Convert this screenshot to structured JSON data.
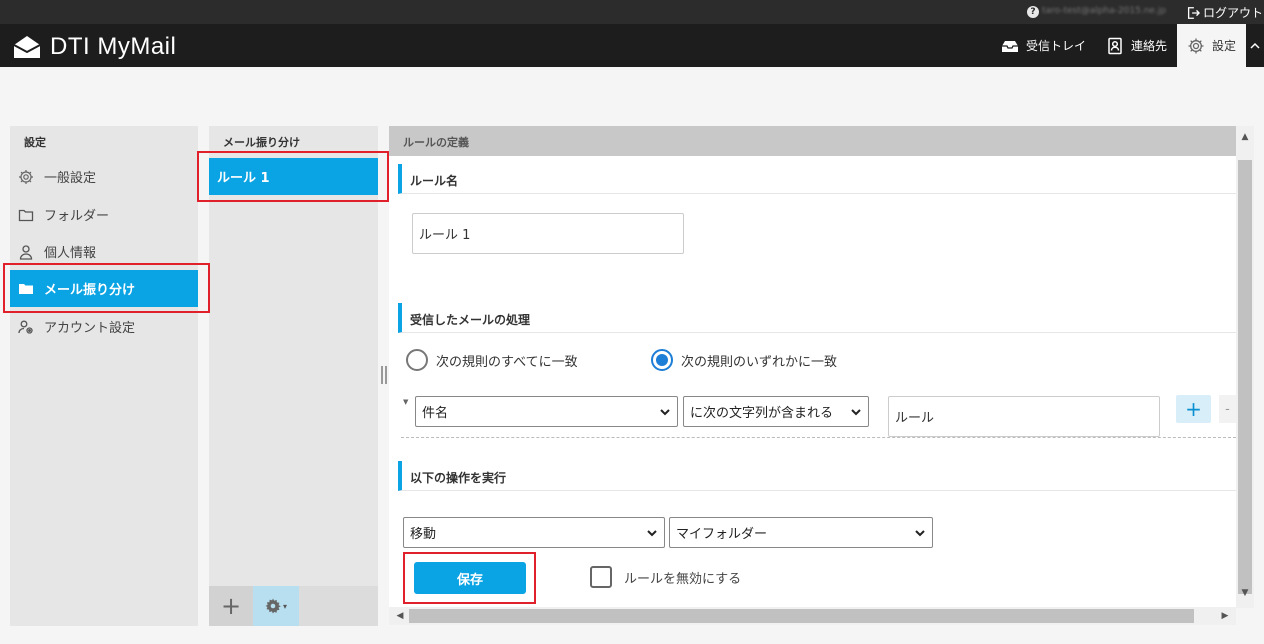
{
  "topbar": {
    "help_glyph": "?",
    "user_email": "taro-test@alpha-2015.ne.jp",
    "logout_label": "ログアウト"
  },
  "header": {
    "brand": "DTI MyMail",
    "nav": {
      "inbox": "受信トレイ",
      "contacts": "連絡先",
      "settings": "設定"
    }
  },
  "settings_panel": {
    "title": "設定",
    "items": [
      {
        "label": "一般設定",
        "icon": "gear-icon"
      },
      {
        "label": "フォルダー",
        "icon": "folder-icon"
      },
      {
        "label": "個人情報",
        "icon": "person-icon"
      },
      {
        "label": "メール振り分け",
        "icon": "folder-icon",
        "active": true
      },
      {
        "label": "アカウント設定",
        "icon": "account-settings-icon"
      }
    ]
  },
  "rules_panel": {
    "title": "メール振り分け",
    "rules": [
      "ルール 1"
    ],
    "add_glyph": "+",
    "gear_caret": "▾"
  },
  "definition": {
    "header": "ルールの定義",
    "rule_name_section": "ルール名",
    "rule_name_value": "ルール 1",
    "processing_section": "受信したメールの処理",
    "radio_all": "次の規則のすべてに一致",
    "radio_any": "次の規則のいずれかに一致",
    "radio_selected": "any",
    "condition": {
      "field": "件名",
      "operator": "に次の文字列が含まれる",
      "value": "ルール",
      "add_glyph": "+",
      "remove_glyph": "-"
    },
    "actions_section": "以下の操作を実行",
    "action": "移動",
    "target_folder": "マイフォルダー",
    "save_label": "保存",
    "disable_label": "ルールを無効にする",
    "disable_checked": false
  },
  "colors": {
    "accent": "#0aa3e3",
    "header_bg": "#1d1d1d",
    "annotation": "#e0202a"
  }
}
